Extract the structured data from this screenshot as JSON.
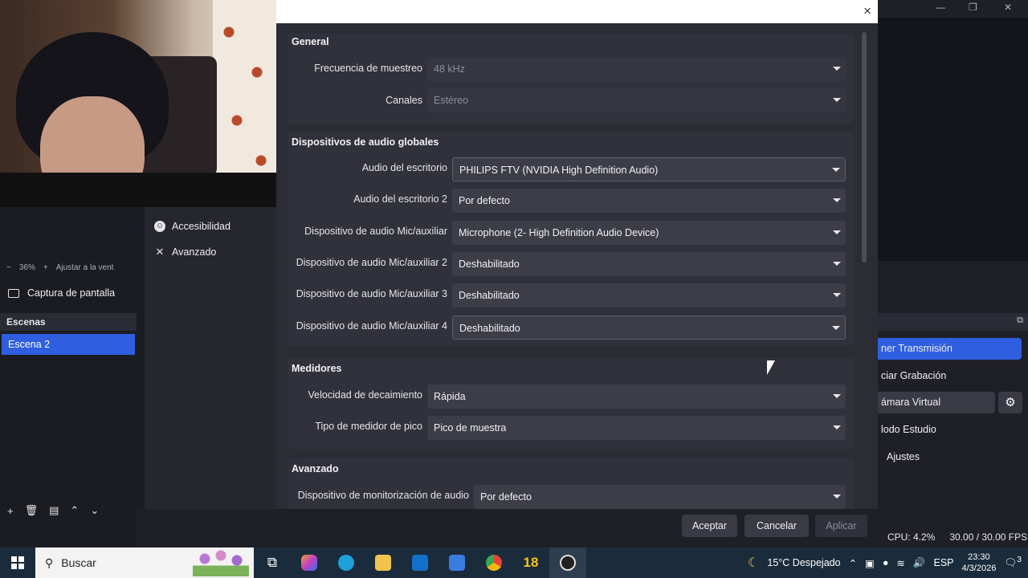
{
  "dialog": {
    "close_label": "×",
    "sections": {
      "general": {
        "title": "General",
        "sample_rate_label": "Frecuencia de muestreo",
        "sample_rate_value": "48 kHz",
        "channels_label": "Canales",
        "channels_value": "Estéreo"
      },
      "devices": {
        "title": "Dispositivos de audio globales",
        "desktop_label": "Audio del escritorio",
        "desktop_value": "PHILIPS FTV (NVIDIA High Definition Audio)",
        "desktop2_label": "Audio del escritorio 2",
        "desktop2_value": "Por defecto",
        "mic_label": "Dispositivo de audio Mic/auxiliar",
        "mic_value": "Microphone (2- High Definition Audio Device)",
        "mic2_label": "Dispositivo de audio Mic/auxiliar 2",
        "mic2_value": "Deshabilitado",
        "mic3_label": "Dispositivo de audio Mic/auxiliar 3",
        "mic3_value": "Deshabilitado",
        "mic4_label": "Dispositivo de audio Mic/auxiliar 4",
        "mic4_value": "Deshabilitado"
      },
      "meters": {
        "title": "Medidores",
        "decay_label": "Velocidad de decaimiento",
        "decay_value": "Rápida",
        "peak_label": "Tipo de medidor de pico",
        "peak_value": "Pico de muestra"
      },
      "advanced": {
        "title": "Avanzado",
        "monitoring_label": "Dispositivo de monitorización de audio",
        "monitoring_value": "Por defecto"
      }
    },
    "buttons": {
      "accept": "Aceptar",
      "cancel": "Cancelar",
      "apply": "Aplicar"
    }
  },
  "settings_sidebar": {
    "items": [
      {
        "label": "Accesibilidad",
        "icon": "accessibility-icon"
      },
      {
        "label": "Avanzado",
        "icon": "wrench-icon"
      }
    ]
  },
  "obs": {
    "zoom": {
      "minus": "−",
      "value": "36%",
      "plus": "+",
      "fit_label": "Ajustar a la vent"
    },
    "source_label": "Captura de pantalla",
    "scenes_header": "Escenas",
    "scene_selected": "Escena 2",
    "controls": {
      "stream": "ner Transmisión",
      "record": "ciar Grabación",
      "virtual_cam": "ámara Virtual",
      "studio": "lodo Estudio",
      "settings": "Ajustes"
    },
    "status": {
      "cpu": "CPU: 4.2%",
      "fps": "30.00 / 30.00 FPS"
    }
  },
  "taskbar": {
    "search_placeholder": "Buscar",
    "badge_18": "18",
    "weather": "15°C  Despejado",
    "lang": "ESP",
    "time": "23:30",
    "date": "4/3/2026",
    "notification_count": "3"
  },
  "colors": {
    "accent": "#2f5fe0",
    "dialog_bg": "#2b2c34",
    "section_bg": "#30313a",
    "select_bg": "#3c3d47",
    "taskbar_bg": "#1a2b3c"
  }
}
